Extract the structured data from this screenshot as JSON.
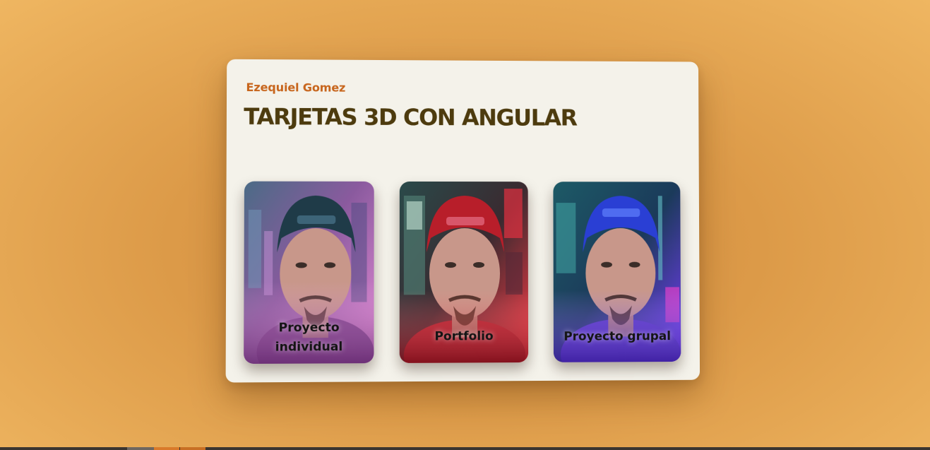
{
  "header": {
    "author": "Ezequiel Gomez",
    "title": "TARJETAS 3D CON ANGULAR"
  },
  "cards": [
    {
      "label_line1": "Proyecto",
      "label_line2": "individual",
      "cap_color": "#1f3b48",
      "bg_color": "#8a5a9e",
      "glow_color": "#e48bd6"
    },
    {
      "label": "Portfolio",
      "cap_color": "#b81e2a",
      "bg_color": "#2f2630",
      "glow_color": "#ff3a44"
    },
    {
      "label": "Proyecto grupal",
      "cap_color": "#2a3fd4",
      "bg_color": "#1d5a66",
      "glow_color": "#7a3cff"
    }
  ],
  "colors": {
    "background": "#dc9a48",
    "panel": "#f4f2ea",
    "author": "#c7651c",
    "title": "#4d3b0e"
  }
}
